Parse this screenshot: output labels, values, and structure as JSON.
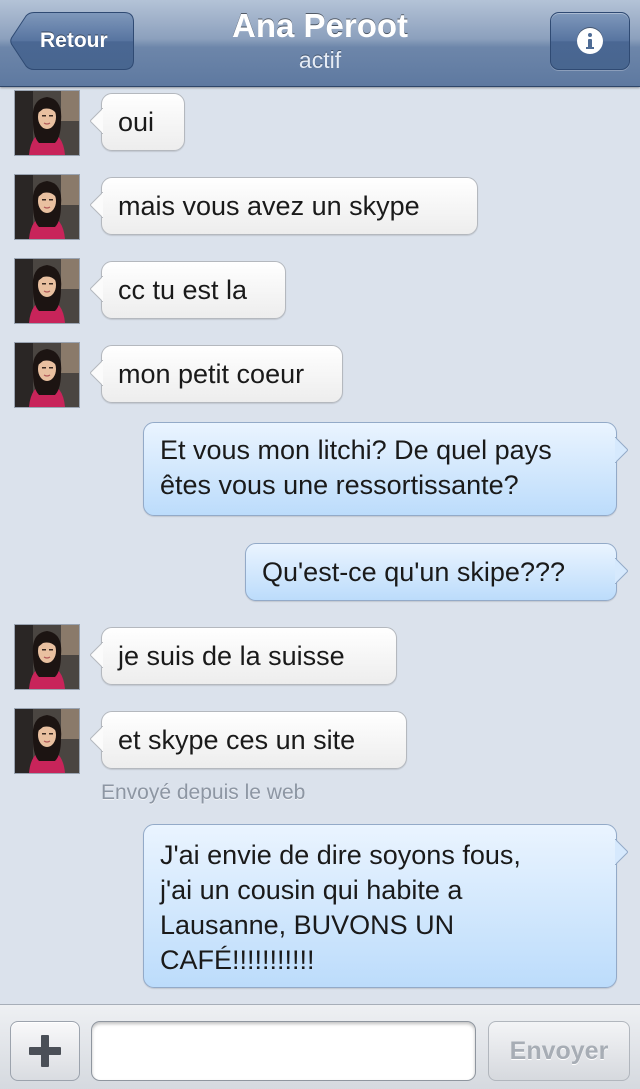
{
  "nav": {
    "back_label": "Retour",
    "title": "Ana Peroot",
    "status": "actif",
    "info_icon": "info-icon"
  },
  "messages": [
    {
      "from": "contact",
      "text": "oui"
    },
    {
      "from": "contact",
      "text": "mais vous avez un skype"
    },
    {
      "from": "contact",
      "text": "cc tu est la"
    },
    {
      "from": "contact",
      "text": "mon petit coeur"
    },
    {
      "from": "me",
      "lines": [
        "Et vous mon litchi? De quel pays",
        "êtes vous une ressortissante?"
      ]
    },
    {
      "from": "me",
      "text": "Qu'est-ce qu'un skipe???"
    },
    {
      "from": "contact",
      "text": "je suis de la suisse"
    },
    {
      "from": "contact",
      "text": "et skype ces un site"
    },
    {
      "from": "me",
      "lines": [
        "J'ai envie de dire soyons fous,",
        "j'ai un cousin qui habite a",
        "Lausanne, BUVONS UN",
        "CAFÉ!!!!!!!!!!!"
      ]
    }
  ],
  "sent_note": "Envoyé depuis le web",
  "composer": {
    "plus_icon": "plus-icon",
    "input_value": "",
    "send_label": "Envoyer"
  },
  "colors": {
    "navbar": "#6d86aa",
    "incoming_bubble": "#ffffff",
    "outgoing_bubble": "#bcdcfb",
    "background": "#dbe2ec"
  }
}
